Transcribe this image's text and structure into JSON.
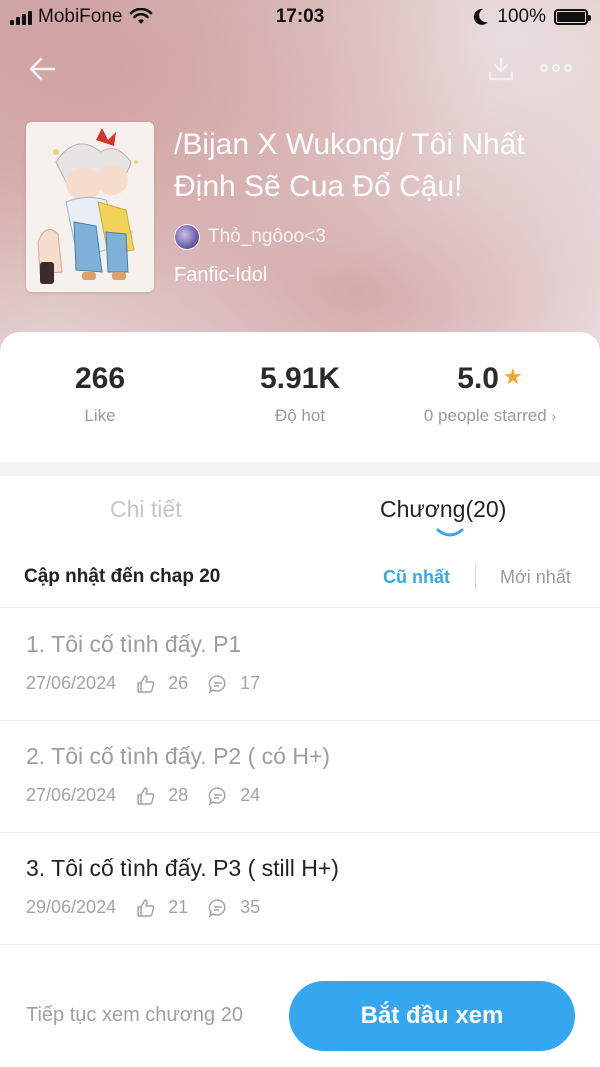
{
  "status_bar": {
    "carrier": "MobiFone",
    "time": "17:03",
    "battery": "100%"
  },
  "story": {
    "title": "/Bijan X Wukong/ Tôi Nhất\nĐịnh Sẽ Cua Đổ Cậu!",
    "author": "Thỏ_ngôoo<3",
    "genre": "Fanfic-Idol"
  },
  "stats": {
    "likes": {
      "value": "266",
      "label": "Like"
    },
    "hot": {
      "value": "5.91K",
      "label": "Độ hot"
    },
    "rating": {
      "value": "5.0",
      "label": "0 people starred"
    }
  },
  "tabs": {
    "detail": "Chi tiết",
    "chapters": "Chương(20)"
  },
  "chapter_list": {
    "header": "Cập nhật đến chap 20",
    "sort_oldest": "Cũ nhất",
    "sort_newest": "Mới nhất",
    "items": [
      {
        "title": "1. Tôi cố tình đấy. P1",
        "date": "27/06/2024",
        "likes": "26",
        "comments": "17",
        "read": true
      },
      {
        "title": "2. Tôi cố tình đấy. P2 ( có H+)",
        "date": "27/06/2024",
        "likes": "28",
        "comments": "24",
        "read": true
      },
      {
        "title": "3. Tôi cố tình đấy. P3 ( still H+)",
        "date": "29/06/2024",
        "likes": "21",
        "comments": "35",
        "read": false
      }
    ]
  },
  "bottom": {
    "continue_label": "Tiếp tục xem chương 20",
    "start_button": "Bắt đầu xem"
  },
  "colors": {
    "accent": "#35a6f0",
    "star": "#f3a629"
  },
  "icons": {
    "back": "arrow-left-icon",
    "download": "download-icon",
    "more": "more-dots-icon",
    "like": "thumbs-up-icon",
    "comment": "comment-icon",
    "star": "star-icon"
  }
}
